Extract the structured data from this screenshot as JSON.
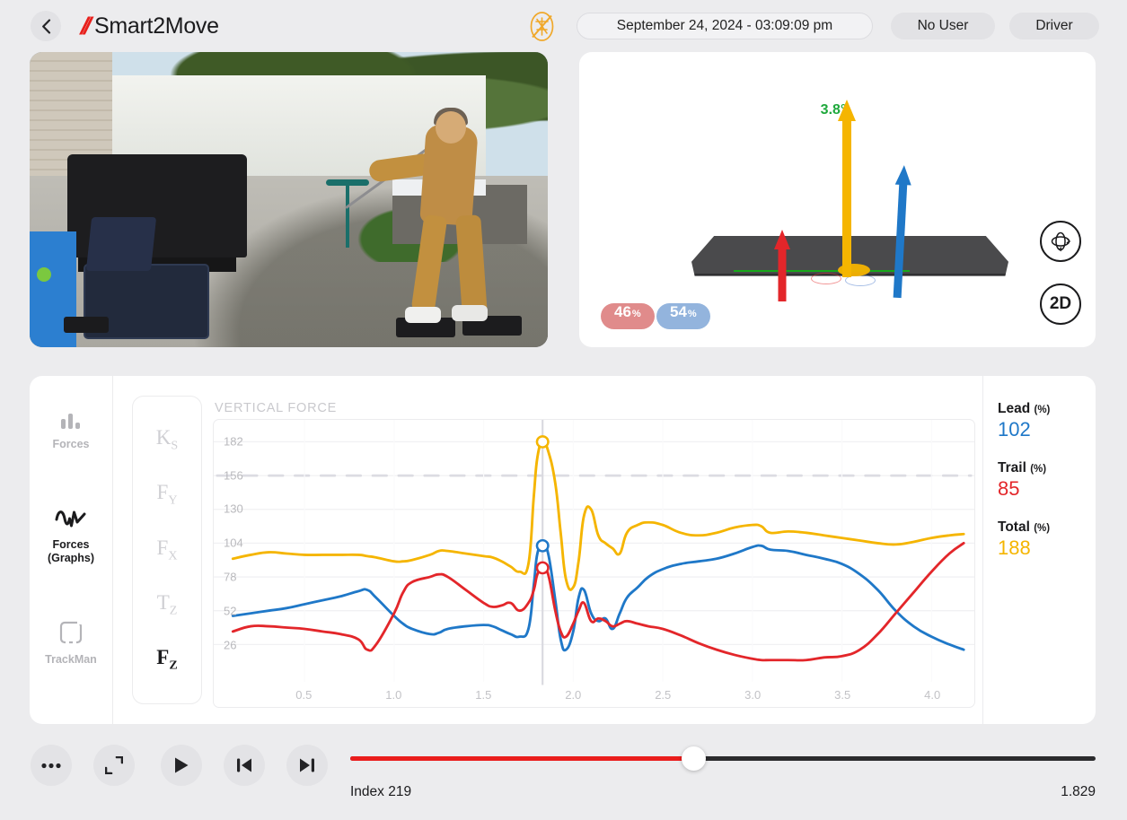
{
  "header": {
    "back_icon": "chevron-left-icon",
    "brand_mark": "//",
    "brand_name": "Smart2Move",
    "club_status_icon": "no-club-icon",
    "date_time": "September 24, 2024 - 03:09:09 pm",
    "user": "No User",
    "club": "Driver"
  },
  "force3d": {
    "angle": "3.8°",
    "angle_color": "#1fa83c",
    "badge_left": {
      "value": "46",
      "unit": "%",
      "color": "#e08b8b"
    },
    "badge_right": {
      "value": "54",
      "unit": "%",
      "color": "#93b4dd"
    },
    "rotate_icon": "rotate-3d-icon",
    "view_toggle": "2D",
    "arrows": [
      {
        "name": "trail-force-arrow",
        "color": "#e3262a"
      },
      {
        "name": "total-force-arrow",
        "color": "#f5b500"
      },
      {
        "name": "lead-force-arrow",
        "color": "#1f78c8"
      }
    ]
  },
  "graph": {
    "modes": [
      {
        "id": "forces",
        "label": "Forces",
        "icon": "bar-chart-icon",
        "active": false
      },
      {
        "id": "forces-graphs",
        "label": "Forces\n(Graphs)",
        "label_line1": "Forces",
        "label_line2": "(Graphs)",
        "icon": "waveform-icon",
        "active": true
      },
      {
        "id": "trackman",
        "label": "TrackMan",
        "icon": "trackman-icon",
        "active": false
      }
    ],
    "channels": [
      {
        "id": "ks",
        "label": "Ks",
        "base": "K",
        "sub": "S",
        "active": false
      },
      {
        "id": "fy",
        "label": "FY",
        "base": "F",
        "sub": "Y",
        "active": false
      },
      {
        "id": "fx",
        "label": "FX",
        "base": "F",
        "sub": "X",
        "active": false
      },
      {
        "id": "tz",
        "label": "TZ",
        "base": "T",
        "sub": "Z",
        "active": false
      },
      {
        "id": "fz",
        "label": "FZ",
        "base": "F",
        "sub": "Z",
        "active": true
      }
    ],
    "metrics": [
      {
        "name": "Lead",
        "unit": "(%)",
        "value": "102",
        "color": "#1f78c8"
      },
      {
        "name": "Trail",
        "unit": "(%)",
        "value": "85",
        "color": "#e3262a"
      },
      {
        "name": "Total",
        "unit": "(%)",
        "value": "188",
        "color": "#f5b500"
      }
    ]
  },
  "chart_data": {
    "type": "line",
    "title": "VERTICAL FORCE",
    "xlabel": "",
    "ylabel": "",
    "grid": true,
    "legend_position": "right",
    "xlim": [
      0.08,
      4.22
    ],
    "ylim": [
      0,
      195
    ],
    "xticks": [
      0.5,
      1.0,
      1.5,
      2.0,
      2.5,
      3.0,
      3.5,
      4.0
    ],
    "yticks": [
      26,
      52,
      78,
      104,
      130,
      156,
      182
    ],
    "threshold_line": {
      "value": 156,
      "style": "dashed",
      "color": "#dcdce2"
    },
    "playhead": {
      "x": 1.829,
      "index": 219
    },
    "markers": [
      {
        "series": "Total",
        "x": 1.829,
        "y": 182,
        "color": "#f5b500"
      },
      {
        "series": "Lead",
        "x": 1.829,
        "y": 102,
        "color": "#1f78c8"
      },
      {
        "series": "Trail",
        "x": 1.829,
        "y": 85,
        "color": "#e3262a"
      }
    ],
    "x": [
      0.1,
      0.2,
      0.3,
      0.4,
      0.5,
      0.6,
      0.7,
      0.8,
      0.85,
      0.9,
      1.0,
      1.05,
      1.1,
      1.2,
      1.25,
      1.3,
      1.4,
      1.5,
      1.55,
      1.6,
      1.65,
      1.7,
      1.75,
      1.78,
      1.8,
      1.829,
      1.86,
      1.9,
      1.93,
      1.96,
      2.0,
      2.03,
      2.06,
      2.1,
      2.14,
      2.18,
      2.22,
      2.26,
      2.3,
      2.36,
      2.42,
      2.5,
      2.6,
      2.7,
      2.8,
      2.9,
      3.0,
      3.05,
      3.1,
      3.2,
      3.3,
      3.4,
      3.5,
      3.6,
      3.7,
      3.8,
      3.9,
      4.0,
      4.1,
      4.18
    ],
    "series": [
      {
        "name": "Total",
        "color": "#f5b500",
        "values": [
          92,
          95,
          97,
          96,
          95,
          95,
          95,
          95,
          94,
          93,
          90,
          90,
          91,
          95,
          98,
          98,
          96,
          94,
          93,
          90,
          86,
          82,
          88,
          140,
          170,
          182,
          175,
          150,
          112,
          76,
          70,
          90,
          125,
          130,
          110,
          104,
          100,
          96,
          112,
          118,
          120,
          118,
          112,
          110,
          112,
          116,
          118,
          117,
          112,
          113,
          112,
          110,
          108,
          106,
          104,
          103,
          105,
          108,
          110,
          111
        ]
      },
      {
        "name": "Lead",
        "color": "#1f78c8",
        "values": [
          48,
          50,
          52,
          54,
          57,
          60,
          63,
          67,
          68,
          62,
          48,
          42,
          38,
          34,
          35,
          38,
          40,
          41,
          40,
          37,
          34,
          32,
          38,
          72,
          96,
          102,
          96,
          60,
          30,
          22,
          36,
          62,
          68,
          50,
          44,
          46,
          38,
          50,
          62,
          70,
          78,
          84,
          88,
          90,
          92,
          96,
          101,
          102,
          99,
          98,
          95,
          92,
          88,
          80,
          68,
          52,
          40,
          32,
          26,
          22
        ]
      },
      {
        "name": "Trail",
        "color": "#e3262a",
        "values": [
          36,
          40,
          40,
          39,
          38,
          36,
          34,
          30,
          22,
          26,
          50,
          66,
          74,
          78,
          80,
          78,
          68,
          58,
          55,
          56,
          58,
          52,
          58,
          68,
          80,
          85,
          80,
          52,
          36,
          32,
          42,
          52,
          58,
          44,
          46,
          44,
          40,
          42,
          44,
          42,
          40,
          38,
          33,
          27,
          22,
          18,
          15,
          14,
          14,
          14,
          14,
          16,
          17,
          22,
          34,
          50,
          66,
          82,
          96,
          104
        ]
      }
    ]
  },
  "playback": {
    "more_icon": "more-dots-icon",
    "expand_icon": "expand-icon",
    "play_icon": "play-icon",
    "prev_icon": "skip-previous-icon",
    "next_icon": "skip-next-icon",
    "index_label": "Index 219",
    "time_label": "1.829",
    "progress_pct": 46,
    "fill_color": "#ea1d1c"
  }
}
